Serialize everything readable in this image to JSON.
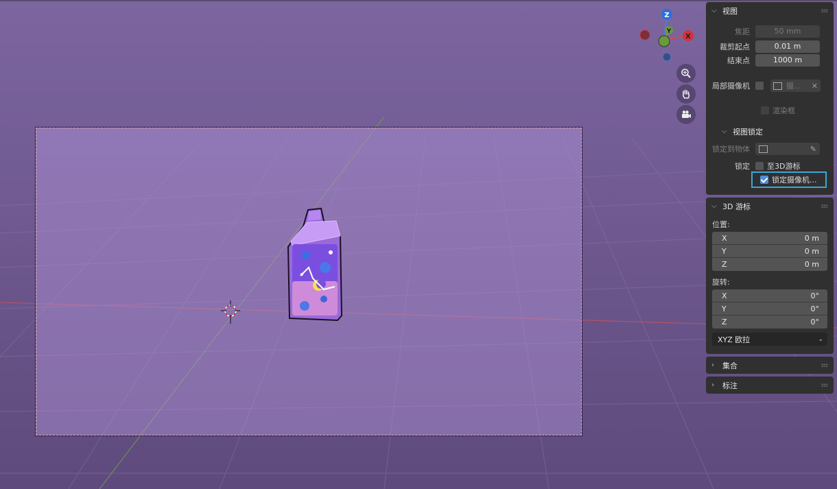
{
  "viewport": {
    "gizmo": {
      "z": "Z",
      "y": "Y",
      "x": "X"
    },
    "nav_icons": [
      "zoom-icon",
      "hand-icon",
      "camera-icon"
    ]
  },
  "panel": {
    "view": {
      "title": "视图",
      "focal_label": "焦距",
      "focal_value": "50 mm",
      "clip_start_label": "裁剪起点",
      "clip_start_value": "0.01 m",
      "clip_end_label": "结束点",
      "clip_end_value": "1000 m",
      "local_camera_label": "局部摄像机",
      "local_camera_value": "摄...",
      "render_region_label": "渲染框"
    },
    "view_lock": {
      "title": "视图锁定",
      "lock_object_label": "锁定到物体",
      "lock_label": "锁定",
      "to_cursor_label": "至3D游标",
      "lock_camera_label": "锁定摄像机..."
    },
    "cursor": {
      "title": "3D 游标",
      "location_label": "位置:",
      "loc": [
        {
          "axis": "X",
          "value": "0 m"
        },
        {
          "axis": "Y",
          "value": "0 m"
        },
        {
          "axis": "Z",
          "value": "0 m"
        }
      ],
      "rotation_label": "旋转:",
      "rot": [
        {
          "axis": "X",
          "value": "0°"
        },
        {
          "axis": "Y",
          "value": "0°"
        },
        {
          "axis": "Z",
          "value": "0°"
        }
      ],
      "mode": "XYZ 欧拉"
    },
    "collection": {
      "title": "集合"
    },
    "annotation": {
      "title": "标注"
    }
  }
}
